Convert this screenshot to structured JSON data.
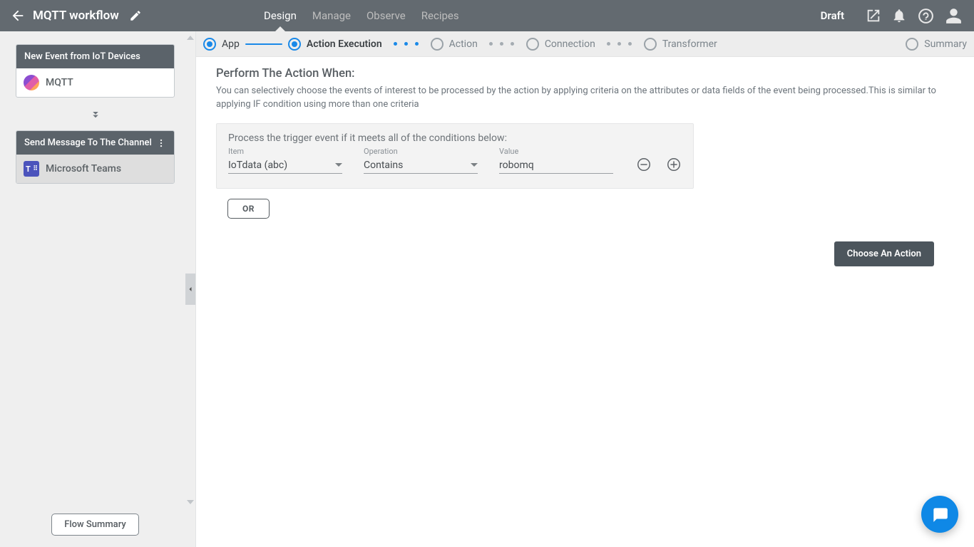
{
  "header": {
    "title": "MQTT workflow",
    "tabs": [
      "Design",
      "Manage",
      "Observe",
      "Recipes"
    ],
    "active_tab": "Design",
    "status": "Draft"
  },
  "sidebar": {
    "cards": [
      {
        "title": "New Event from IoT Devices",
        "app": "MQTT"
      },
      {
        "title": "Send Message To The Channel",
        "app": "Microsoft Teams"
      }
    ],
    "flow_summary_label": "Flow Summary"
  },
  "stepper": {
    "steps": [
      {
        "label": "App",
        "state": "done"
      },
      {
        "label": "Action Execution",
        "state": "active"
      },
      {
        "label": "Action",
        "state": "pending"
      },
      {
        "label": "Connection",
        "state": "pending"
      },
      {
        "label": "Transformer",
        "state": "pending"
      },
      {
        "label": "Summary",
        "state": "pending"
      }
    ]
  },
  "content": {
    "heading": "Perform The Action When:",
    "description": "You can selectively choose the events of interest to be processed by the action by applying criteria on the attributes or data fields of the event being processed.This is similar to applying IF condition using more than one criteria",
    "cond_title": "Process the trigger event if it meets all of the conditions below:",
    "labels": {
      "item": "Item",
      "operation": "Operation",
      "value": "Value"
    },
    "condition": {
      "item": "IoTdata (abc)",
      "operation": "Contains",
      "value": "robomq"
    },
    "or_label": "OR",
    "choose_label": "Choose An Action"
  }
}
